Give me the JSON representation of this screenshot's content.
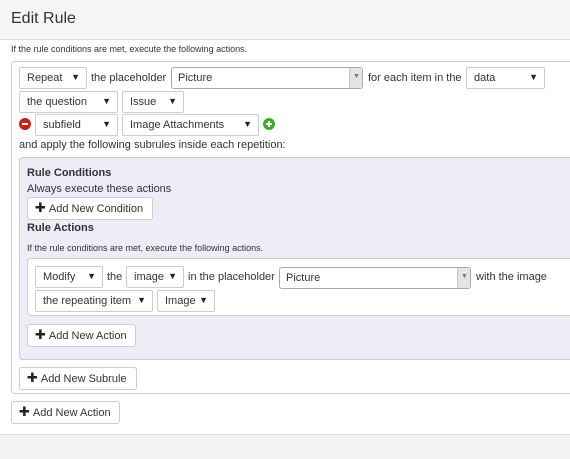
{
  "page": {
    "title": "Edit Rule"
  },
  "rule": {
    "note": "If the rule conditions are met, execute the following actions.",
    "row1": {
      "action_select": "Repeat",
      "text_placeholder": "the placeholder",
      "placeholder_combo": "Picture",
      "text_for_each": "for each item in the",
      "source_select": "data"
    },
    "row2": {
      "scope_select": "the question",
      "question_select": "Issue"
    },
    "row3": {
      "field_select": "subfield",
      "subfield_select": "Image Attachments"
    },
    "apply_text": "and apply the following subrules inside each repetition:",
    "subrule": {
      "conditions_heading": "Rule Conditions",
      "conditions_text": "Always execute these actions",
      "add_condition_label": "Add New Condition",
      "actions_heading": "Rule Actions",
      "actions_note": "If the rule conditions are met, execute the following actions.",
      "action": {
        "action_select": "Modify",
        "text_the": "the",
        "property_select": "image",
        "text_in_placeholder": "in the placeholder",
        "placeholder_combo": "Picture",
        "text_with_image": "with the image",
        "source_select": "the repeating item",
        "type_select": "Image"
      },
      "add_action_label": "Add New Action"
    },
    "add_subrule_label": "Add New Subrule"
  },
  "add_action_label": "Add New Action",
  "icons": {
    "dropdown": "caret-down-icon",
    "plus": "plus-icon",
    "remove": "minus-circle-icon",
    "add": "plus-circle-icon"
  },
  "colors": {
    "remove_icon": "#cc1d1d",
    "add_icon": "#3aae2a",
    "subrule_background": "#ecedf7",
    "header_background": "#f5f5f5"
  }
}
